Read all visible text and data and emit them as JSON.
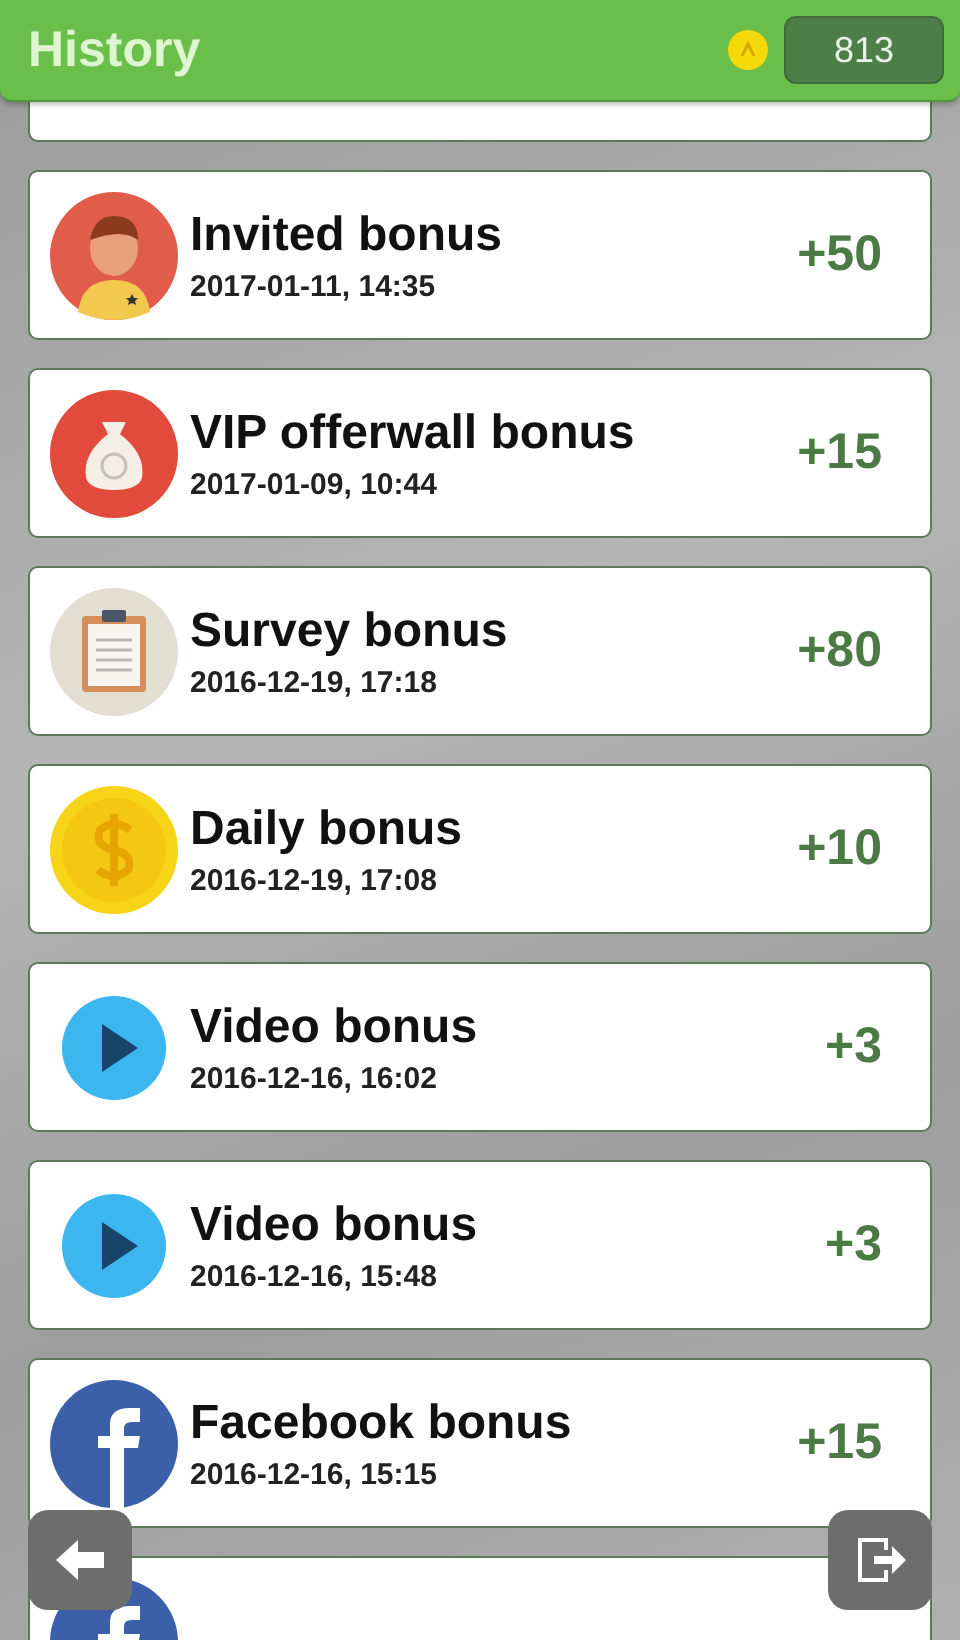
{
  "header": {
    "title": "History",
    "balance": "813"
  },
  "items": [
    {
      "kind": "blank"
    },
    {
      "kind": "person",
      "title": "Invited bonus",
      "date": "2017-01-11, 14:35",
      "amount": "+50"
    },
    {
      "kind": "bag",
      "title": "VIP offerwall bonus",
      "date": "2017-01-09, 10:44",
      "amount": "+15"
    },
    {
      "kind": "clipboard",
      "title": "Survey bonus",
      "date": "2016-12-19, 17:18",
      "amount": "+80"
    },
    {
      "kind": "coin",
      "title": "Daily bonus",
      "date": "2016-12-19, 17:08",
      "amount": "+10"
    },
    {
      "kind": "play",
      "title": "Video bonus",
      "date": "2016-12-16, 16:02",
      "amount": "+3"
    },
    {
      "kind": "play",
      "title": "Video bonus",
      "date": "2016-12-16, 15:48",
      "amount": "+3"
    },
    {
      "kind": "facebook",
      "title": "Facebook bonus",
      "date": "2016-12-16, 15:15",
      "amount": "+15"
    },
    {
      "kind": "facebook"
    }
  ]
}
